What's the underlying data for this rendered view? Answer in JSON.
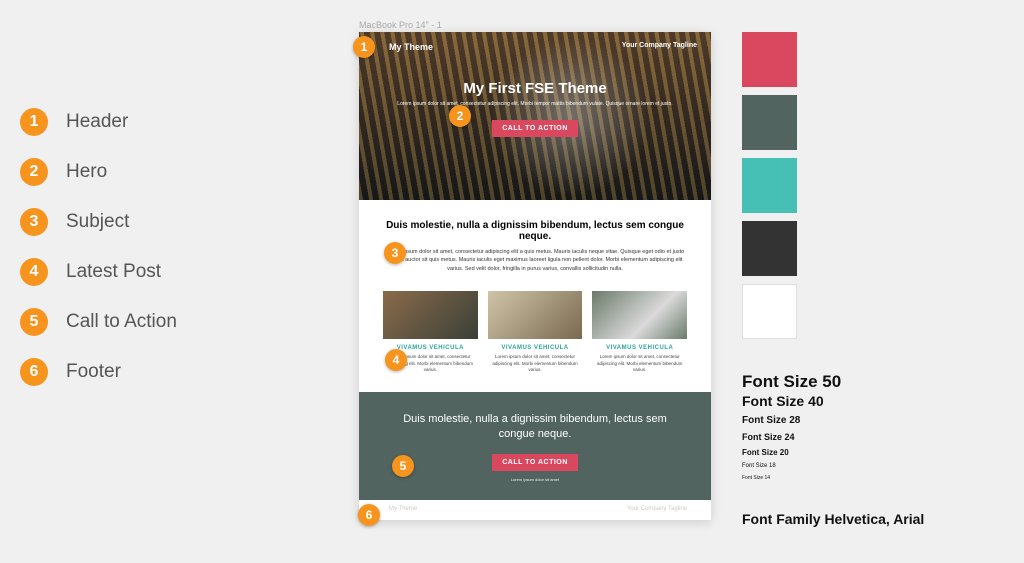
{
  "legend": {
    "items": [
      {
        "num": "1",
        "label": "Header"
      },
      {
        "num": "2",
        "label": "Hero"
      },
      {
        "num": "3",
        "label": "Subject"
      },
      {
        "num": "4",
        "label": "Latest Post"
      },
      {
        "num": "5",
        "label": "Call to Action"
      },
      {
        "num": "6",
        "label": "Footer"
      }
    ]
  },
  "frame_label": "MacBook Pro 14\" - 1",
  "mockup": {
    "topbar": {
      "brand": "My Theme",
      "tagline": "Your Company Tagline"
    },
    "hero": {
      "title": "My First FSE Theme",
      "subtitle": "Lorem ipsum dolor sit amet, consectetur adipiscing elit. Morbi tempor mattis bibendum vulate. Quisque ornare lorem et justo.",
      "cta": "CALL TO ACTION"
    },
    "subject": {
      "heading": "Duis molestie, nulla a dignissim bibendum, lectus sem congue neque.",
      "body": "Lorem ipsum dolor sit amet, consectetur adipiscing elit a quis metus. Mauris iaculis neque vitae. Quisque eget odio et justo cursus auctor sit quis metus. Mauris iaculis eget maximus laoreet ligula non pellent dolor. Morbi elementum adipiscing elit varius. Sed velit dolor, fringilla in purus varius, convallis sollicitudin nulla."
    },
    "posts": [
      {
        "title": "VIVAMUS VEHICULA",
        "body": "Lorem ipsum dolor sit amet, consectetur adipiscing elit. Morbi elementum bibendum varius."
      },
      {
        "title": "VIVAMUS VEHICULA",
        "body": "Lorem ipsum dolor sit amet, consectetur adipiscing elit. Morbi elementum bibendum varius."
      },
      {
        "title": "VIVAMUS VEHICULA",
        "body": "Lorem ipsum dolor sit amet, consectetur adipiscing elit. Morbi elementum bibendum varius."
      }
    ],
    "cta_section": {
      "heading": "Duis molestie, nulla a dignissim bibendum, lectus sem congue neque.",
      "button": "CALL TO ACTION",
      "sub": "Lorem ipsum dolor sit amet"
    },
    "footer": {
      "brand": "My Theme",
      "tagline": "Your Company Tagline"
    }
  },
  "pins": [
    "1",
    "2",
    "3",
    "4",
    "5",
    "6"
  ],
  "palette": {
    "c1": "#d9485f",
    "c2": "#51645f",
    "c3": "#46c0b4",
    "c4": "#333333",
    "c5": "#ffffff"
  },
  "typescale": {
    "s50": "Font Size 50",
    "s40": "Font Size 40",
    "s28": "Font Size 28",
    "s24": "Font Size 24",
    "s20": "Font Size 20",
    "s18": "Font Size 18",
    "s14": "Font Size 14",
    "family": "Font Family Helvetica, Arial"
  }
}
